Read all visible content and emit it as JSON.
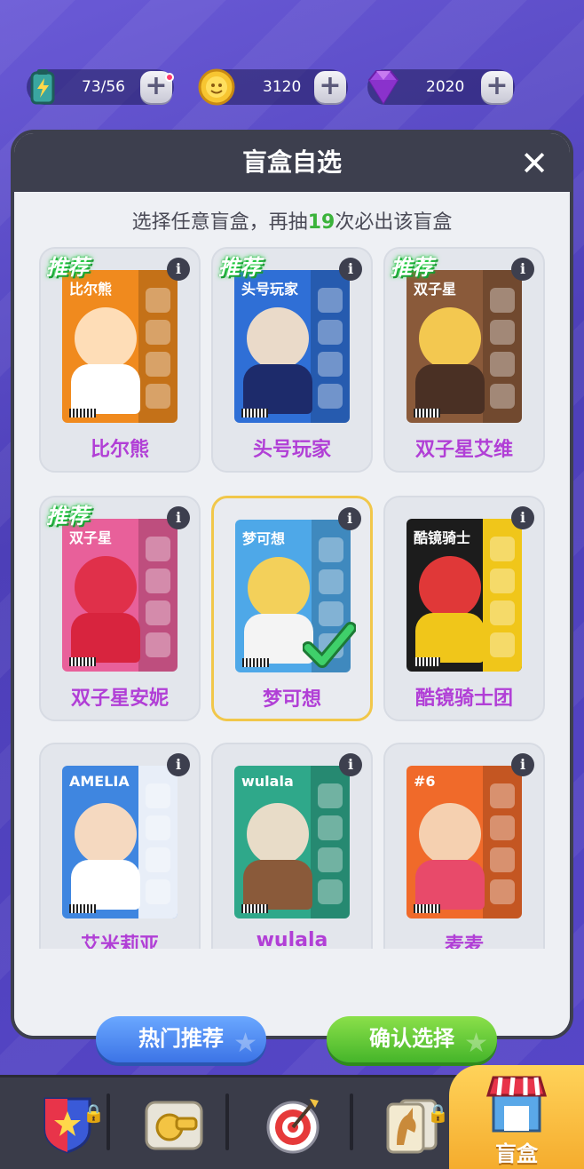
{
  "currencies": [
    {
      "name": "energy",
      "value": "73/56",
      "icon": "battery-icon"
    },
    {
      "name": "coins",
      "value": "3120",
      "icon": "coin-icon"
    },
    {
      "name": "gems",
      "value": "2020",
      "icon": "gem-icon"
    }
  ],
  "modal": {
    "title": "盲盒自选",
    "subtitle_pre": "选择任意盲盒，再抽",
    "subtitle_count": "19",
    "subtitle_post": "次必出该盲盒"
  },
  "cards": [
    {
      "name": "比尔熊",
      "recommended": "推荐",
      "box_label": "比尔熊",
      "color": "#f08a1e",
      "selected": false
    },
    {
      "name": "头号玩家",
      "recommended": "推荐",
      "box_label": "头号玩家",
      "color": "#2f6fd6",
      "selected": false
    },
    {
      "name": "双子星艾维",
      "recommended": "推荐",
      "box_label": "双子星",
      "color": "#8a5a3a",
      "selected": false
    },
    {
      "name": "双子星安妮",
      "recommended": "推荐",
      "box_label": "双子星",
      "color": "#e8609a",
      "selected": false
    },
    {
      "name": "梦可想",
      "recommended": "",
      "box_label": "梦可想",
      "color": "#4ea8e8",
      "selected": true
    },
    {
      "name": "酷镜骑士团",
      "recommended": "",
      "box_label": "酷镜骑士",
      "color": "#1c1c1c",
      "selected": false
    },
    {
      "name": "艾米莉亚",
      "recommended": "",
      "box_label": "AMELIA",
      "color": "#3f86e0",
      "selected": false
    },
    {
      "name": "wulala",
      "recommended": "",
      "box_label": "wulala",
      "color": "#2fa88a",
      "selected": false
    },
    {
      "name": "麦麦",
      "recommended": "",
      "box_label": "#6",
      "color": "#f06a2a",
      "selected": false
    }
  ],
  "buttons": {
    "hot": "热门推荐",
    "confirm": "确认选择"
  },
  "nav": {
    "items": [
      "badge-icon",
      "whistle-icon",
      "target-icon",
      "unicorn-card-icon",
      "shop-icon"
    ],
    "active_label": "盲盒"
  }
}
